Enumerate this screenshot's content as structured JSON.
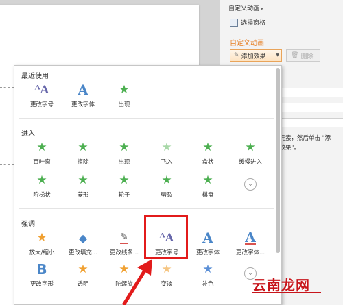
{
  "panel": {
    "title": "自定义动画",
    "select_pane": "选择窗格",
    "custom_animation": "自定义动画",
    "add_effect": "添加效果",
    "delete": "删除",
    "hint_line1": "个元素，然后单击 \"添",
    "hint_line2": "加效果\"。"
  },
  "popup": {
    "recent": {
      "title": "最近使用",
      "items": [
        {
          "label": "更改字号",
          "icon": "font-size-icon"
        },
        {
          "label": "更改字体",
          "icon": "font-change-icon"
        },
        {
          "label": "出现",
          "icon": "star-icon"
        }
      ]
    },
    "entrance": {
      "title": "进入",
      "items": [
        {
          "label": "百叶窗",
          "icon": "blinds-star-icon"
        },
        {
          "label": "擦除",
          "icon": "wipe-star-icon"
        },
        {
          "label": "出现",
          "icon": "appear-star-icon"
        },
        {
          "label": "飞入",
          "icon": "fly-in-star-icon"
        },
        {
          "label": "盒状",
          "icon": "box-star-icon"
        },
        {
          "label": "缓慢进入",
          "icon": "crawl-in-star-icon"
        },
        {
          "label": "阶梯状",
          "icon": "step-star-icon"
        },
        {
          "label": "菱形",
          "icon": "diamond-star-icon"
        },
        {
          "label": "轮子",
          "icon": "wheel-star-icon"
        },
        {
          "label": "劈裂",
          "icon": "split-star-icon"
        },
        {
          "label": "棋盘",
          "icon": "checkerboard-star-icon"
        }
      ]
    },
    "emphasis": {
      "title": "强调",
      "items": [
        {
          "label": "放大/缩小",
          "icon": "grow-shrink-star-icon"
        },
        {
          "label": "更改填充...",
          "icon": "fill-color-icon"
        },
        {
          "label": "更改线条...",
          "icon": "line-color-icon"
        },
        {
          "label": "更改字号",
          "icon": "font-size-icon"
        },
        {
          "label": "更改字体",
          "icon": "font-change-icon"
        },
        {
          "label": "更改字体...",
          "icon": "font-color-icon"
        },
        {
          "label": "更改字形",
          "icon": "font-style-icon"
        },
        {
          "label": "透明",
          "icon": "transparency-star-icon"
        },
        {
          "label": "陀螺旋",
          "icon": "spin-star-icon"
        },
        {
          "label": "变淡",
          "icon": "fade-star-icon"
        },
        {
          "label": "补色",
          "icon": "complementary-star-icon"
        }
      ]
    }
  },
  "watermark": "云南龙网",
  "colors": {
    "accent_orange": "#e67e22",
    "highlight_red": "#e21b1b",
    "star_green": "#4caf50",
    "font_blue": "#4a86c8"
  }
}
